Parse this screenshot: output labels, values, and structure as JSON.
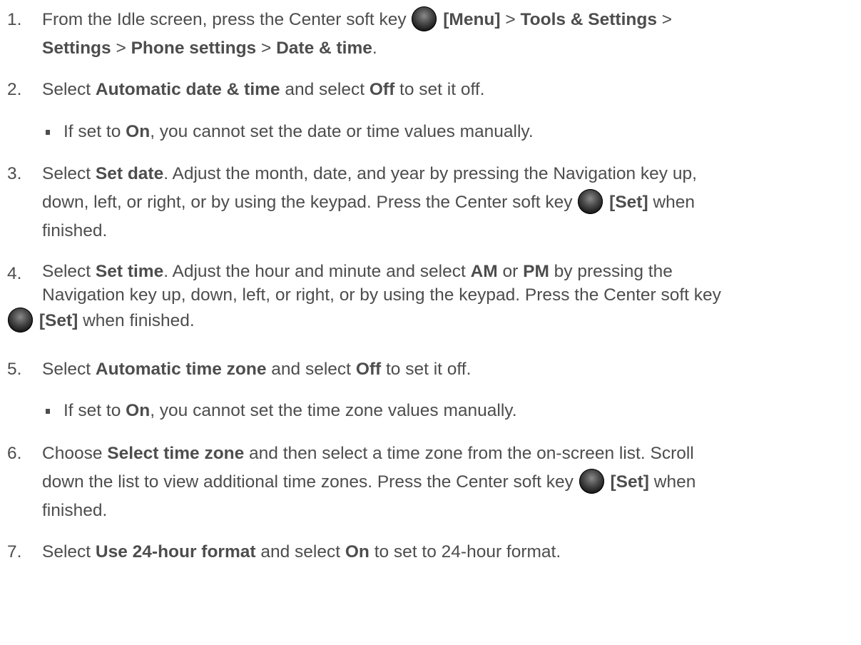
{
  "steps": [
    {
      "number": "1.",
      "lines": [
        [
          {
            "t": "From the Idle screen, press the Center soft key "
          },
          {
            "icon": "center-soft-key-icon"
          },
          {
            "t": " "
          },
          {
            "t": "[Menu]",
            "b": true
          },
          {
            "t": " > "
          },
          {
            "t": "Tools & Settings",
            "b": true
          },
          {
            "t": " >"
          }
        ],
        [
          {
            "t": "Settings",
            "b": true
          },
          {
            "t": " > "
          },
          {
            "t": "Phone settings",
            "b": true
          },
          {
            "t": " > "
          },
          {
            "t": "Date & time",
            "b": true
          },
          {
            "t": "."
          }
        ]
      ]
    },
    {
      "number": "2.",
      "lines": [
        [
          {
            "t": "Select "
          },
          {
            "t": "Automatic date & time",
            "b": true
          },
          {
            "t": " and select "
          },
          {
            "t": "Off",
            "b": true
          },
          {
            "t": " to set it off."
          }
        ]
      ],
      "bullet": [
        {
          "t": "If set to "
        },
        {
          "t": "On",
          "b": true
        },
        {
          "t": ", you cannot set the date or time values manually."
        }
      ]
    },
    {
      "number": "3.",
      "lines": [
        [
          {
            "t": "Select "
          },
          {
            "t": "Set date",
            "b": true
          },
          {
            "t": ". Adjust the month, date, and year by pressing the Navigation key up,"
          }
        ],
        [
          {
            "t": "down, left, or right, or by using the keypad. Press the Center soft key "
          },
          {
            "icon": "center-soft-key-icon"
          },
          {
            "t": " "
          },
          {
            "t": "[Set]",
            "b": true
          },
          {
            "t": " when"
          }
        ],
        [
          {
            "t": "finished."
          }
        ]
      ]
    },
    {
      "number": "4.",
      "lines": [
        [
          {
            "t": "Select "
          },
          {
            "t": "Set time",
            "b": true
          },
          {
            "t": ". Adjust the hour and minute and select "
          },
          {
            "t": "AM",
            "b": true
          },
          {
            "t": " or "
          },
          {
            "t": "PM",
            "b": true
          },
          {
            "t": " by pressing the"
          }
        ],
        [
          {
            "t": "Navigation key up, down, left, or right, or by using the keypad. Press the Center soft key"
          }
        ],
        [
          {
            "icon": "center-soft-key-icon"
          },
          {
            "t": " "
          },
          {
            "t": "[Set]",
            "b": true
          },
          {
            "t": " when finished."
          }
        ]
      ]
    },
    {
      "number": "5.",
      "lines": [
        [
          {
            "t": "Select "
          },
          {
            "t": "Automatic time zone",
            "b": true
          },
          {
            "t": " and select "
          },
          {
            "t": "Off",
            "b": true
          },
          {
            "t": " to set it off."
          }
        ]
      ],
      "bullet": [
        {
          "t": "If set to "
        },
        {
          "t": "On",
          "b": true
        },
        {
          "t": ", you cannot set the time zone values manually."
        }
      ]
    },
    {
      "number": "6.",
      "lines": [
        [
          {
            "t": "Choose "
          },
          {
            "t": "Select time zone",
            "b": true
          },
          {
            "t": " and then select a time zone from the on-screen list. Scroll"
          }
        ],
        [
          {
            "t": "down the list to view additional time zones. Press the Center soft key "
          },
          {
            "icon": "center-soft-key-icon"
          },
          {
            "t": " "
          },
          {
            "t": "[Set]",
            "b": true
          },
          {
            "t": " when"
          }
        ],
        [
          {
            "t": "finished."
          }
        ]
      ]
    },
    {
      "number": "7.",
      "lines": [
        [
          {
            "t": "Select "
          },
          {
            "t": "Use 24-hour format",
            "b": true
          },
          {
            "t": " and select "
          },
          {
            "t": "On",
            "b": true
          },
          {
            "t": " to set to 24-hour format."
          }
        ]
      ]
    }
  ]
}
